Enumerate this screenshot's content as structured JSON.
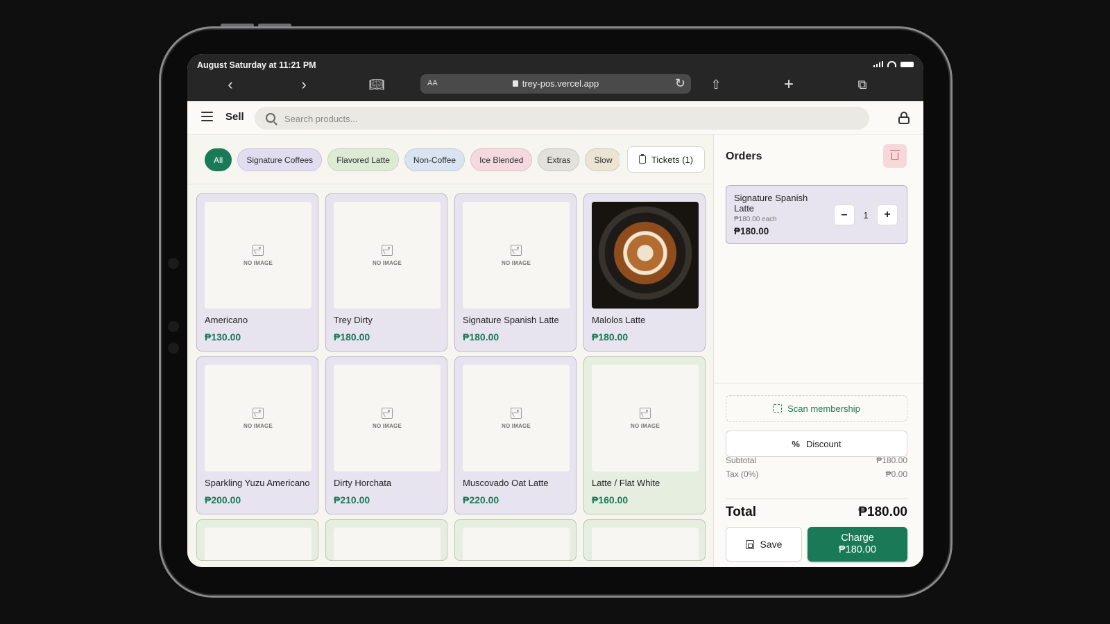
{
  "status": {
    "time": "August Saturday at 11:21 PM"
  },
  "browser": {
    "aa_label": "AA",
    "url": "trey-pos.vercel.app"
  },
  "header": {
    "title": "Sell",
    "search_placeholder": "Search products..."
  },
  "categories": [
    {
      "label": "All",
      "active": true,
      "color": "#1a7a57"
    },
    {
      "label": "Signature Coffees",
      "color": "#e2dcf0"
    },
    {
      "label": "Flavored Latte",
      "color": "#ddebd5"
    },
    {
      "label": "Non-Coffee",
      "color": "#d9e3f1"
    },
    {
      "label": "Ice Blended",
      "color": "#f4d9df"
    },
    {
      "label": "Extras",
      "color": "#e3e1dc"
    },
    {
      "label": "Slow",
      "color": "#ece4d2"
    }
  ],
  "tickets_label": "Tickets (1)",
  "products": [
    {
      "name": "Americano",
      "price": "₱130.00",
      "image": "NO IMAGE",
      "color": "purple"
    },
    {
      "name": "Trey Dirty",
      "price": "₱180.00",
      "image": "NO IMAGE",
      "color": "purple"
    },
    {
      "name": "Signature Spanish Latte",
      "price": "₱180.00",
      "image": "NO IMAGE",
      "color": "purple"
    },
    {
      "name": "Malolos Latte",
      "price": "₱180.00",
      "image": "photo",
      "color": "purple"
    },
    {
      "name": "Sparkling Yuzu Americano",
      "price": "₱200.00",
      "image": "NO IMAGE",
      "color": "purple"
    },
    {
      "name": "Dirty Horchata",
      "price": "₱210.00",
      "image": "NO IMAGE",
      "color": "purple"
    },
    {
      "name": "Muscovado Oat Latte",
      "price": "₱220.00",
      "image": "NO IMAGE",
      "color": "purple"
    },
    {
      "name": "Latte / Flat White",
      "price": "₱160.00",
      "image": "NO IMAGE",
      "color": "green"
    }
  ],
  "orders": {
    "title": "Orders",
    "items": [
      {
        "name": "Signature Spanish Latte",
        "each": "₱180.00 each",
        "total": "₱180.00",
        "qty": "1"
      }
    ],
    "scan_label": "Scan membership",
    "discount_label": "Discount",
    "subtotal_label": "Subtotal",
    "subtotal_value": "₱180.00",
    "tax_label": "Tax (0%)",
    "tax_value": "₱0.00",
    "total_label": "Total",
    "total_value": "₱180.00",
    "save_label": "Save",
    "charge_label": "Charge",
    "charge_amount": "₱180.00"
  }
}
